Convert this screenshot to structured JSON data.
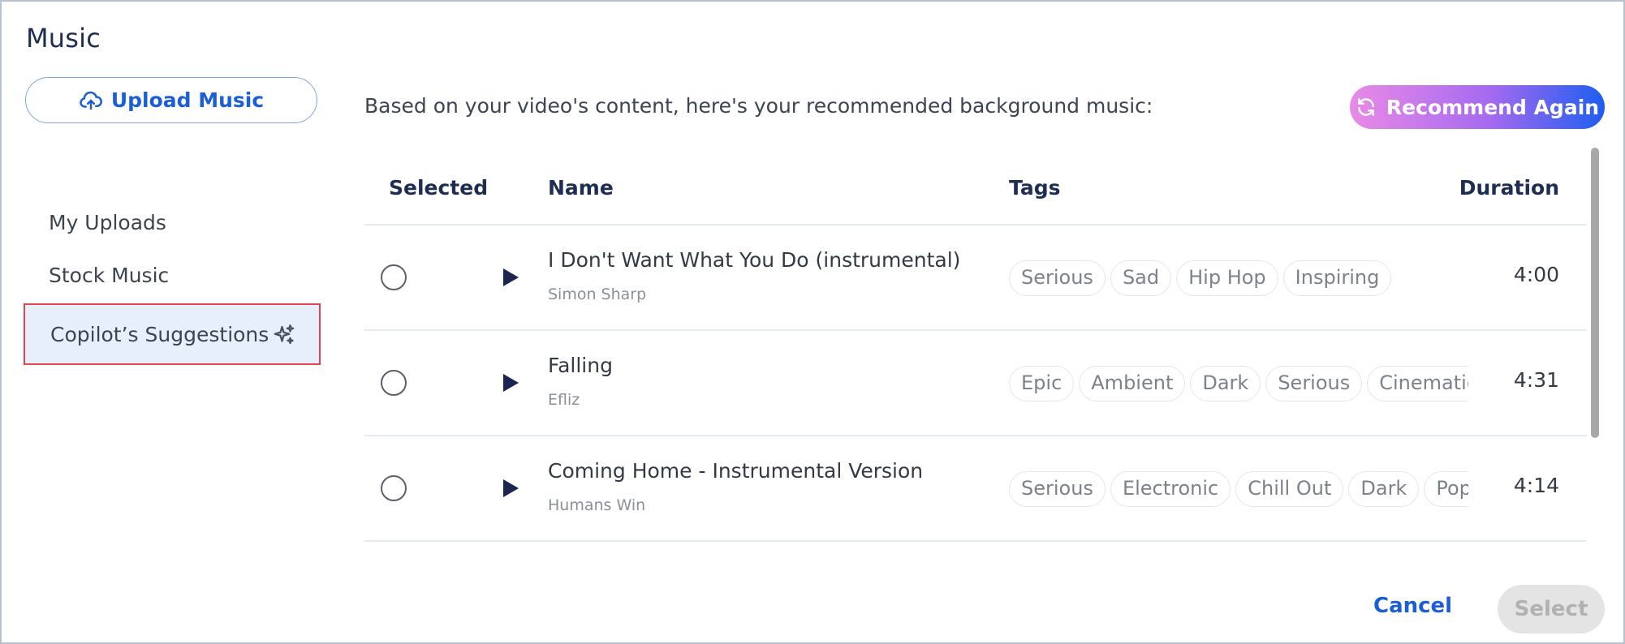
{
  "dialog": {
    "title": "Music"
  },
  "sidebar": {
    "upload_label": "Upload Music",
    "items": [
      {
        "label": "My Uploads"
      },
      {
        "label": "Stock Music"
      },
      {
        "label": "Copilot’s Suggestions"
      }
    ]
  },
  "main": {
    "intro": "Based on your video's content, here's your recommended background music:",
    "recommend_label": "Recommend Again",
    "columns": {
      "selected": "Selected",
      "name": "Name",
      "tags": "Tags",
      "duration": "Duration"
    },
    "tracks": [
      {
        "name": "I Don't Want What You Do (instrumental)",
        "artist": "Simon Sharp",
        "tags": [
          "Serious",
          "Sad",
          "Hip Hop",
          "Inspiring"
        ],
        "duration": "4:00"
      },
      {
        "name": "Falling",
        "artist": "Efliz",
        "tags": [
          "Epic",
          "Ambient",
          "Dark",
          "Serious",
          "Cinematic"
        ],
        "duration": "4:31"
      },
      {
        "name": "Coming Home - Instrumental Version",
        "artist": "Humans Win",
        "tags": [
          "Serious",
          "Electronic",
          "Chill Out",
          "Dark",
          "Pop"
        ],
        "duration": "4:14"
      }
    ]
  },
  "footer": {
    "cancel_label": "Cancel",
    "select_label": "Select"
  },
  "colors": {
    "accent": "#1b5fd6",
    "highlight_border": "#e0464b",
    "active_bg": "#e8effc"
  }
}
